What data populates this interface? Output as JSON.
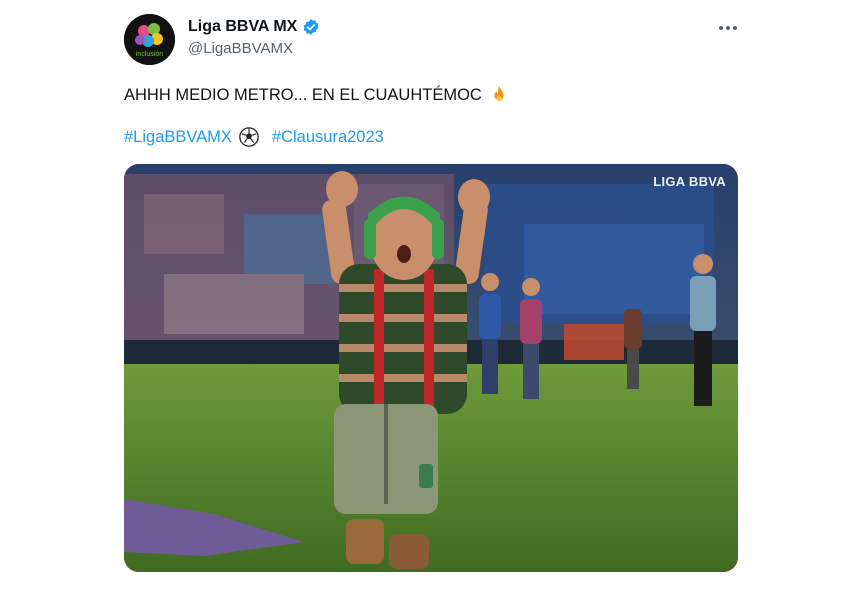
{
  "account": {
    "display_name": "Liga BBVA MX",
    "handle": "@LigaBBVAMX",
    "verified_icon": "verified-badge-icon",
    "avatar_icon": "inclusion-puzzle-logo",
    "avatar_text": "inclusión"
  },
  "tweet": {
    "text": "AHHH MEDIO METRO... EN EL CUAUHTÉMOC",
    "emoji": "fire-icon",
    "hashtags": [
      "#LigaBBVAMX",
      "#Clausura2023"
    ],
    "hashtag_emoji": "soccer-ball-icon"
  },
  "menu": {
    "more_icon": "more-options-icon"
  },
  "media": {
    "watermark": "LIGA BBVA",
    "description_icon": "photo"
  },
  "colors": {
    "link": "#1d9bf0",
    "text": "#0f1419",
    "secondary": "#536471",
    "verified": "#1d9bf0"
  }
}
